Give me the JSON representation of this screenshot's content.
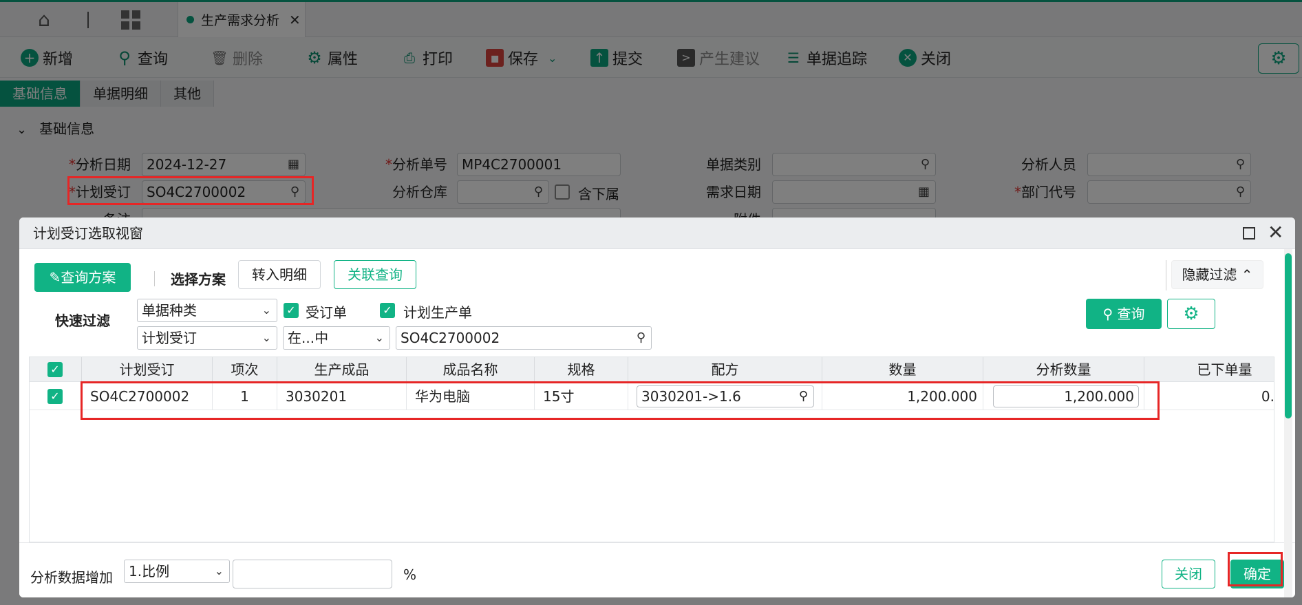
{
  "colors": {
    "accent": "#0aa57f",
    "highlight": "#e62626"
  },
  "topbar": {
    "tab_label": "生产需求分析"
  },
  "toolbar": {
    "new": "新增",
    "query": "查询",
    "delete": "删除",
    "props": "属性",
    "print": "打印",
    "save": "保存",
    "submit": "提交",
    "suggest": "产生建议",
    "trace": "单据追踪",
    "close": "关闭"
  },
  "subtabs": [
    "基础信息",
    "单据明细",
    "其他"
  ],
  "section": {
    "title": "基础信息"
  },
  "form": {
    "analysis_date_label": "分析日期",
    "analysis_date": "2024-12-27",
    "analysis_no_label": "分析单号",
    "analysis_no": "MP4C2700001",
    "doc_type_label": "单据类别",
    "analyst_label": "分析人员",
    "plan_order_label": "计划受订",
    "plan_order": "SO4C2700002",
    "warehouse_label": "分析仓库",
    "include_sub": "含下属",
    "demand_date_label": "需求日期",
    "dept_label": "部门代号",
    "remark_label": "备注",
    "attachment_label": "附件"
  },
  "dialog": {
    "title": "计划受订选取视窗",
    "scheme_btn": "查询方案",
    "select_scheme": "选择方案",
    "import_detail": "转入明细",
    "linked_query": "关联查询",
    "hide_filter": "隐藏过滤",
    "quick_filter": "快速过滤",
    "filter1_field": "单据种类",
    "chk_order": "受订单",
    "chk_plan": "计划生产单",
    "filter2_field": "计划受订",
    "filter2_op": "在...中",
    "filter2_value": "SO4C2700002",
    "query_btn": "查询",
    "columns": [
      "计划受订",
      "项次",
      "生产成品",
      "成品名称",
      "规格",
      "配方",
      "数量",
      "分析数量",
      "已下单量"
    ],
    "rows": [
      {
        "order": "SO4C2700002",
        "item": "1",
        "product": "3030201",
        "name": "华为电脑",
        "spec": "15寸",
        "formula": "3030201->1.6",
        "qty": "1,200.000",
        "analysis_qty": "1,200.000",
        "ordered": "0."
      }
    ],
    "footer": {
      "increase_label": "分析数据增加",
      "increase_mode": "1.比例",
      "increase_value": "",
      "percent": "%",
      "close": "关闭",
      "confirm": "确定"
    }
  }
}
